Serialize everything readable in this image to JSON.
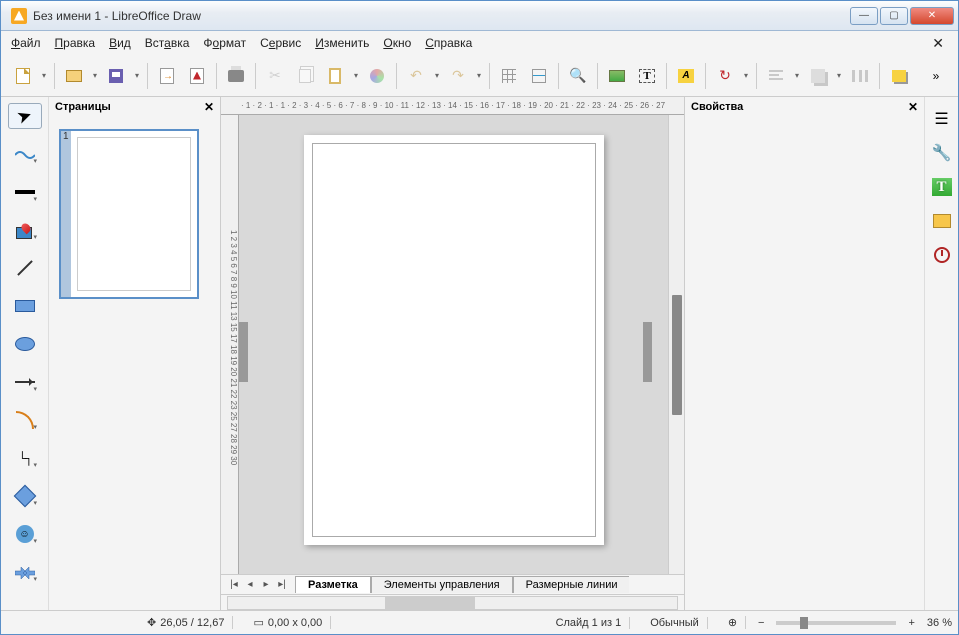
{
  "window": {
    "title": "Без имени 1 - LibreOffice Draw"
  },
  "menu": {
    "file": "Файл",
    "edit": "Правка",
    "view": "Вид",
    "insert": "Вставка",
    "format": "Формат",
    "tools": "Сервис",
    "modify": "Изменить",
    "window": "Окно",
    "help": "Справка"
  },
  "panels": {
    "pages_title": "Страницы",
    "properties_title": "Свойства",
    "page_number": "1"
  },
  "ruler_h": " · 1 · 2 · 1 · 1 · 2 · 3 · 4 · 5 · 6 · 7 · 8 · 9 · 10 · 11 · 12 · 13 · 14 · 15 · 16 · 17 · 18 · 19 · 20 · 21 · 22 · 23 · 24 · 25 · 26 · 27",
  "ruler_v": "1 2 3 4 5 6 7 8 9 10 11 13 15 17 18 19 20 21 22 23 25 27 28 29 30",
  "tabs": {
    "layout": "Разметка",
    "controls": "Элементы управления",
    "dimlines": "Размерные линии"
  },
  "status": {
    "coords": "26,05 / 12,67",
    "size": "0,00 x 0,00",
    "slide": "Слайд 1 из 1",
    "style": "Обычный",
    "zoom": "36 %"
  },
  "icons": {
    "text_T": "T",
    "fontwork_A": "A"
  }
}
